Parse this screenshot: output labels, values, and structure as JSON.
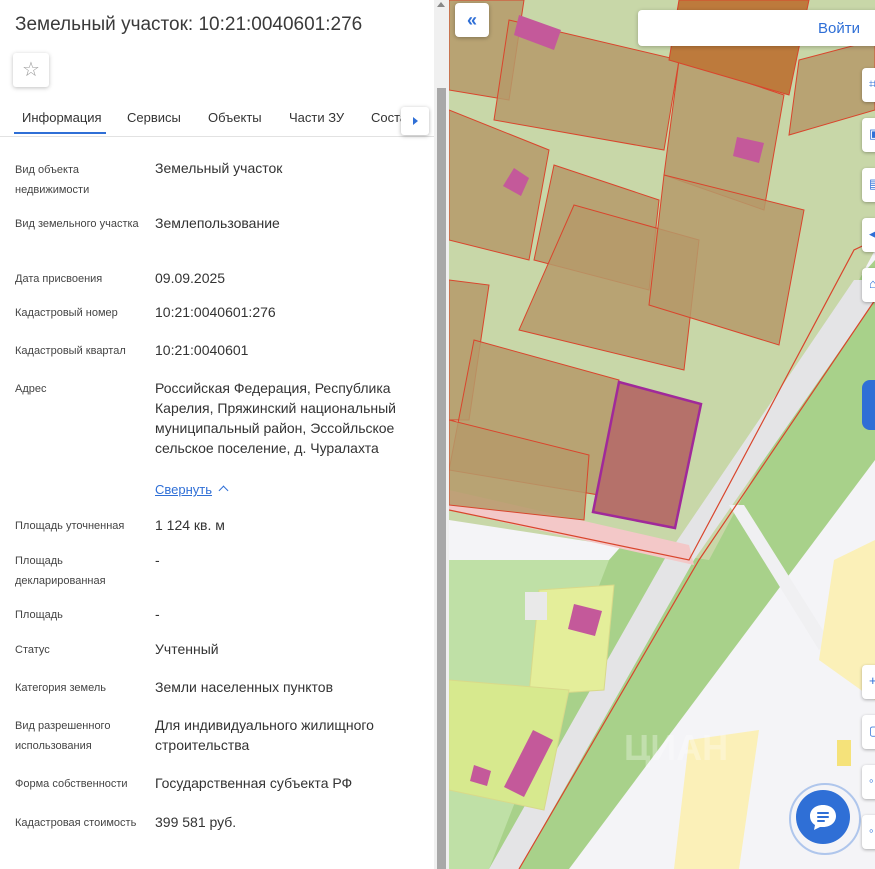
{
  "panel": {
    "title": "Земельный участок: 10:21:0040601:276",
    "tabs": [
      "Информация",
      "Сервисы",
      "Объекты",
      "Части ЗУ",
      "Соста"
    ],
    "fields": [
      {
        "label": "Вид объекта недвижимости",
        "value": "Земельный участок"
      },
      {
        "label": "Вид земельного участка",
        "value": "Землепользование"
      },
      {
        "label": "Дата присвоения",
        "value": "09.09.2025"
      },
      {
        "label": "Кадастровый номер",
        "value": "10:21:0040601:276"
      },
      {
        "label": "Кадастровый квартал",
        "value": "10:21:0040601"
      },
      {
        "label": "Адрес",
        "value": "Российская Федерация, Республика Карелия, Пряжинский национальный муниципальный район, Эссойльское сельское поселение, д. Чуралахта"
      },
      {
        "label": "Площадь уточненная",
        "value": "1 124 кв. м"
      },
      {
        "label": "Площадь декларированная",
        "value": "-"
      },
      {
        "label": "Площадь",
        "value": "-"
      },
      {
        "label": "Статус",
        "value": "Учтенный"
      },
      {
        "label": "Категория земель",
        "value": "Земли населенных пунктов"
      },
      {
        "label": "Вид разрешенного использования",
        "value": "Для индивидуального жилищного строительства"
      },
      {
        "label": "Форма собственности",
        "value": "Государственная субъекта РФ"
      },
      {
        "label": "Кадастровая стоимость",
        "value": "399 581 руб."
      }
    ],
    "collapse_link": "Свернуть"
  },
  "map": {
    "login_label": "Войти",
    "watermark": "ЦИАН",
    "icons": {
      "favorite": "star-icon",
      "collapse_panel": "double-chevron-left-icon",
      "chat": "chat-bubble-icon"
    },
    "colors": {
      "accent": "#2f6fd6",
      "parcel_fill": "#b59a6a",
      "parcel_border": "#d9452c",
      "selected_parcel_fill": "#b5716a",
      "selected_parcel_border": "#a0299a",
      "building": "#c4599a",
      "green_area": "#a8d18a"
    }
  }
}
